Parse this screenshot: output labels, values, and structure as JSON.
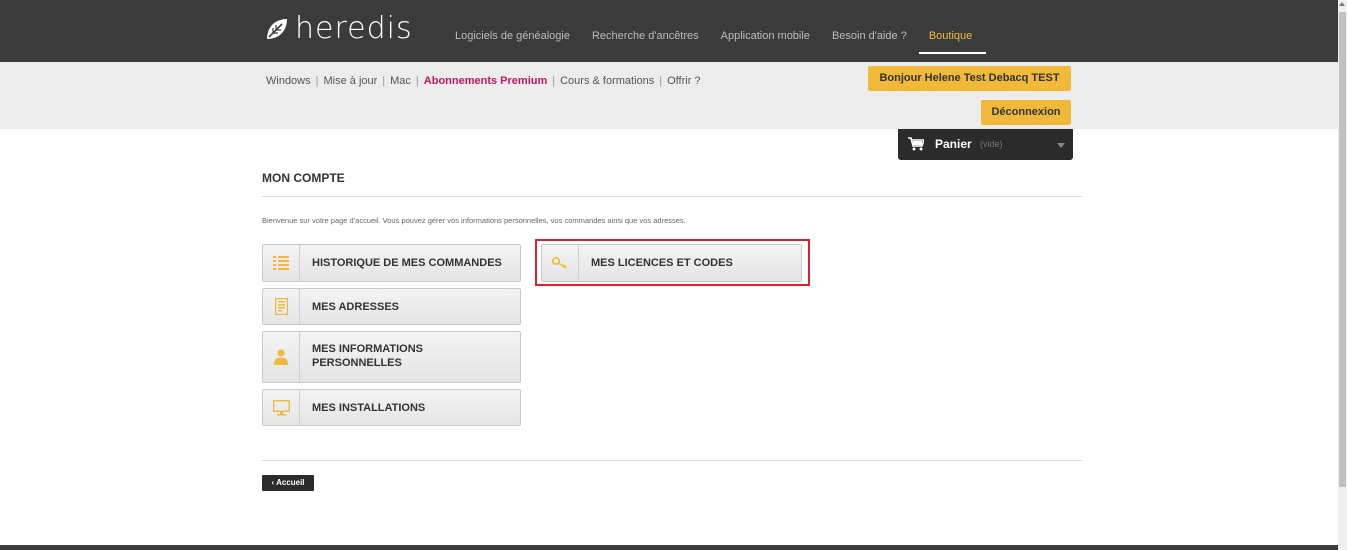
{
  "brand": {
    "name": "heredis"
  },
  "main_nav": [
    {
      "label": "Logiciels de généalogie"
    },
    {
      "label": "Recherche d'ancêtres"
    },
    {
      "label": "Application mobile"
    },
    {
      "label": "Besoin d'aide ?"
    },
    {
      "label": "Boutique"
    }
  ],
  "sub_nav": [
    {
      "label": "Windows"
    },
    {
      "label": "Mise à jour"
    },
    {
      "label": "Mac"
    },
    {
      "label": "Abonnements Premium"
    },
    {
      "label": "Cours & formations"
    },
    {
      "label": "Offrir ?"
    }
  ],
  "user": {
    "greeting": "Bonjour Helene Test Debacq TEST",
    "logout": "Déconnexion"
  },
  "cart": {
    "label": "Panier",
    "status": "(vide)"
  },
  "page": {
    "title": "MON COMPTE",
    "welcome": "Bienvenue sur votre page d'accueil. Vous pouvez gérer vos informations personnelles, vos commandes ainsi que vos adresses."
  },
  "account_links": [
    {
      "label": "HISTORIQUE DE MES COMMANDES",
      "icon": "list-icon"
    },
    {
      "label": "MES ADRESSES",
      "icon": "address-book-icon"
    },
    {
      "label_line1": "MES INFORMATIONS",
      "label_line2": "PERSONNELLES",
      "icon": "user-icon"
    },
    {
      "label": "MES INSTALLATIONS",
      "icon": "monitor-icon"
    },
    {
      "label": "MES LICENCES ET CODES",
      "icon": "key-icon"
    }
  ],
  "back": {
    "label": "Accueil"
  },
  "colors": {
    "accent": "#f0b93a",
    "topbar": "#3b3b3b",
    "premium": "#c2185b",
    "highlight": "#e0202e"
  }
}
